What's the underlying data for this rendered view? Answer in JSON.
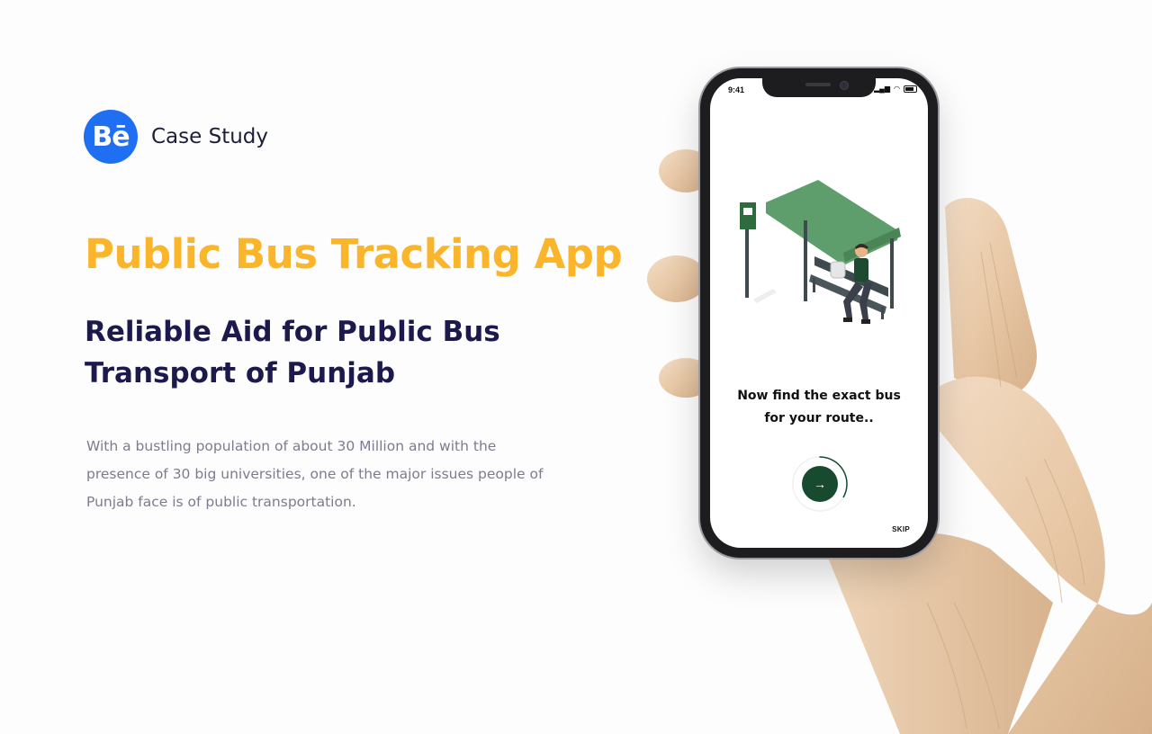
{
  "header": {
    "logo_text": "Bē",
    "label": "Case Study",
    "logo_color": "#1f6ff2"
  },
  "hero": {
    "title": "Public Bus Tracking App",
    "subtitle_line1": "Reliable Aid for Public Bus",
    "subtitle_line2": "Transport of Punjab",
    "description": "With a bustling population of about 30 Million and with the presence of 30 big universities, one of the major issues people of Punjab face is of public transportation.",
    "title_color": "#fbb52a",
    "subtitle_color": "#1c1a4d"
  },
  "phone": {
    "status_time": "9:41",
    "onboarding_line1": "Now find the exact bus",
    "onboarding_line2": "for your route..",
    "next_icon": "→",
    "skip_label": "SKIP",
    "accent_color": "#174a2e",
    "progress": 0.33,
    "illustration_icon": "bus-stop-illustration"
  }
}
